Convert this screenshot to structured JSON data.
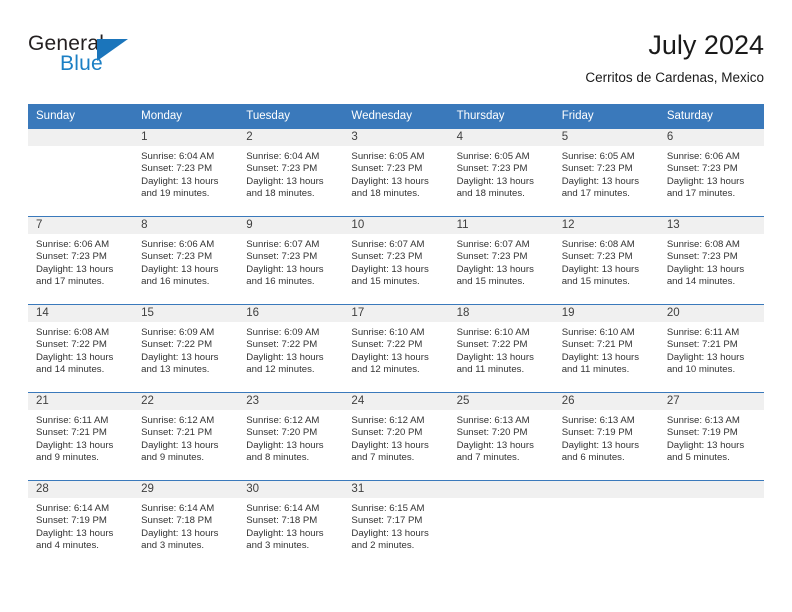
{
  "brand": {
    "name_part1": "General",
    "name_part2": "Blue",
    "flag_icon": "triangle-flag-icon"
  },
  "header": {
    "title": "July 2024",
    "subtitle": "Cerritos de Cardenas, Mexico"
  },
  "weekday_headers": [
    "Sunday",
    "Monday",
    "Tuesday",
    "Wednesday",
    "Thursday",
    "Friday",
    "Saturday"
  ],
  "colors": {
    "header_blue": "#3a79bb",
    "brand_blue": "#1b75bb",
    "daynum_band": "#f0f0f0",
    "text": "#333333"
  },
  "weeks": [
    [
      {
        "day": "",
        "sunrise": "",
        "sunset": "",
        "daylight_line1": "",
        "daylight_line2": ""
      },
      {
        "day": "1",
        "sunrise": "Sunrise: 6:04 AM",
        "sunset": "Sunset: 7:23 PM",
        "daylight_line1": "Daylight: 13 hours",
        "daylight_line2": "and 19 minutes."
      },
      {
        "day": "2",
        "sunrise": "Sunrise: 6:04 AM",
        "sunset": "Sunset: 7:23 PM",
        "daylight_line1": "Daylight: 13 hours",
        "daylight_line2": "and 18 minutes."
      },
      {
        "day": "3",
        "sunrise": "Sunrise: 6:05 AM",
        "sunset": "Sunset: 7:23 PM",
        "daylight_line1": "Daylight: 13 hours",
        "daylight_line2": "and 18 minutes."
      },
      {
        "day": "4",
        "sunrise": "Sunrise: 6:05 AM",
        "sunset": "Sunset: 7:23 PM",
        "daylight_line1": "Daylight: 13 hours",
        "daylight_line2": "and 18 minutes."
      },
      {
        "day": "5",
        "sunrise": "Sunrise: 6:05 AM",
        "sunset": "Sunset: 7:23 PM",
        "daylight_line1": "Daylight: 13 hours",
        "daylight_line2": "and 17 minutes."
      },
      {
        "day": "6",
        "sunrise": "Sunrise: 6:06 AM",
        "sunset": "Sunset: 7:23 PM",
        "daylight_line1": "Daylight: 13 hours",
        "daylight_line2": "and 17 minutes."
      }
    ],
    [
      {
        "day": "7",
        "sunrise": "Sunrise: 6:06 AM",
        "sunset": "Sunset: 7:23 PM",
        "daylight_line1": "Daylight: 13 hours",
        "daylight_line2": "and 17 minutes."
      },
      {
        "day": "8",
        "sunrise": "Sunrise: 6:06 AM",
        "sunset": "Sunset: 7:23 PM",
        "daylight_line1": "Daylight: 13 hours",
        "daylight_line2": "and 16 minutes."
      },
      {
        "day": "9",
        "sunrise": "Sunrise: 6:07 AM",
        "sunset": "Sunset: 7:23 PM",
        "daylight_line1": "Daylight: 13 hours",
        "daylight_line2": "and 16 minutes."
      },
      {
        "day": "10",
        "sunrise": "Sunrise: 6:07 AM",
        "sunset": "Sunset: 7:23 PM",
        "daylight_line1": "Daylight: 13 hours",
        "daylight_line2": "and 15 minutes."
      },
      {
        "day": "11",
        "sunrise": "Sunrise: 6:07 AM",
        "sunset": "Sunset: 7:23 PM",
        "daylight_line1": "Daylight: 13 hours",
        "daylight_line2": "and 15 minutes."
      },
      {
        "day": "12",
        "sunrise": "Sunrise: 6:08 AM",
        "sunset": "Sunset: 7:23 PM",
        "daylight_line1": "Daylight: 13 hours",
        "daylight_line2": "and 15 minutes."
      },
      {
        "day": "13",
        "sunrise": "Sunrise: 6:08 AM",
        "sunset": "Sunset: 7:23 PM",
        "daylight_line1": "Daylight: 13 hours",
        "daylight_line2": "and 14 minutes."
      }
    ],
    [
      {
        "day": "14",
        "sunrise": "Sunrise: 6:08 AM",
        "sunset": "Sunset: 7:22 PM",
        "daylight_line1": "Daylight: 13 hours",
        "daylight_line2": "and 14 minutes."
      },
      {
        "day": "15",
        "sunrise": "Sunrise: 6:09 AM",
        "sunset": "Sunset: 7:22 PM",
        "daylight_line1": "Daylight: 13 hours",
        "daylight_line2": "and 13 minutes."
      },
      {
        "day": "16",
        "sunrise": "Sunrise: 6:09 AM",
        "sunset": "Sunset: 7:22 PM",
        "daylight_line1": "Daylight: 13 hours",
        "daylight_line2": "and 12 minutes."
      },
      {
        "day": "17",
        "sunrise": "Sunrise: 6:10 AM",
        "sunset": "Sunset: 7:22 PM",
        "daylight_line1": "Daylight: 13 hours",
        "daylight_line2": "and 12 minutes."
      },
      {
        "day": "18",
        "sunrise": "Sunrise: 6:10 AM",
        "sunset": "Sunset: 7:22 PM",
        "daylight_line1": "Daylight: 13 hours",
        "daylight_line2": "and 11 minutes."
      },
      {
        "day": "19",
        "sunrise": "Sunrise: 6:10 AM",
        "sunset": "Sunset: 7:21 PM",
        "daylight_line1": "Daylight: 13 hours",
        "daylight_line2": "and 11 minutes."
      },
      {
        "day": "20",
        "sunrise": "Sunrise: 6:11 AM",
        "sunset": "Sunset: 7:21 PM",
        "daylight_line1": "Daylight: 13 hours",
        "daylight_line2": "and 10 minutes."
      }
    ],
    [
      {
        "day": "21",
        "sunrise": "Sunrise: 6:11 AM",
        "sunset": "Sunset: 7:21 PM",
        "daylight_line1": "Daylight: 13 hours",
        "daylight_line2": "and 9 minutes."
      },
      {
        "day": "22",
        "sunrise": "Sunrise: 6:12 AM",
        "sunset": "Sunset: 7:21 PM",
        "daylight_line1": "Daylight: 13 hours",
        "daylight_line2": "and 9 minutes."
      },
      {
        "day": "23",
        "sunrise": "Sunrise: 6:12 AM",
        "sunset": "Sunset: 7:20 PM",
        "daylight_line1": "Daylight: 13 hours",
        "daylight_line2": "and 8 minutes."
      },
      {
        "day": "24",
        "sunrise": "Sunrise: 6:12 AM",
        "sunset": "Sunset: 7:20 PM",
        "daylight_line1": "Daylight: 13 hours",
        "daylight_line2": "and 7 minutes."
      },
      {
        "day": "25",
        "sunrise": "Sunrise: 6:13 AM",
        "sunset": "Sunset: 7:20 PM",
        "daylight_line1": "Daylight: 13 hours",
        "daylight_line2": "and 7 minutes."
      },
      {
        "day": "26",
        "sunrise": "Sunrise: 6:13 AM",
        "sunset": "Sunset: 7:19 PM",
        "daylight_line1": "Daylight: 13 hours",
        "daylight_line2": "and 6 minutes."
      },
      {
        "day": "27",
        "sunrise": "Sunrise: 6:13 AM",
        "sunset": "Sunset: 7:19 PM",
        "daylight_line1": "Daylight: 13 hours",
        "daylight_line2": "and 5 minutes."
      }
    ],
    [
      {
        "day": "28",
        "sunrise": "Sunrise: 6:14 AM",
        "sunset": "Sunset: 7:19 PM",
        "daylight_line1": "Daylight: 13 hours",
        "daylight_line2": "and 4 minutes."
      },
      {
        "day": "29",
        "sunrise": "Sunrise: 6:14 AM",
        "sunset": "Sunset: 7:18 PM",
        "daylight_line1": "Daylight: 13 hours",
        "daylight_line2": "and 3 minutes."
      },
      {
        "day": "30",
        "sunrise": "Sunrise: 6:14 AM",
        "sunset": "Sunset: 7:18 PM",
        "daylight_line1": "Daylight: 13 hours",
        "daylight_line2": "and 3 minutes."
      },
      {
        "day": "31",
        "sunrise": "Sunrise: 6:15 AM",
        "sunset": "Sunset: 7:17 PM",
        "daylight_line1": "Daylight: 13 hours",
        "daylight_line2": "and 2 minutes."
      },
      {
        "day": "",
        "sunrise": "",
        "sunset": "",
        "daylight_line1": "",
        "daylight_line2": ""
      },
      {
        "day": "",
        "sunrise": "",
        "sunset": "",
        "daylight_line1": "",
        "daylight_line2": ""
      },
      {
        "day": "",
        "sunrise": "",
        "sunset": "",
        "daylight_line1": "",
        "daylight_line2": ""
      }
    ]
  ]
}
